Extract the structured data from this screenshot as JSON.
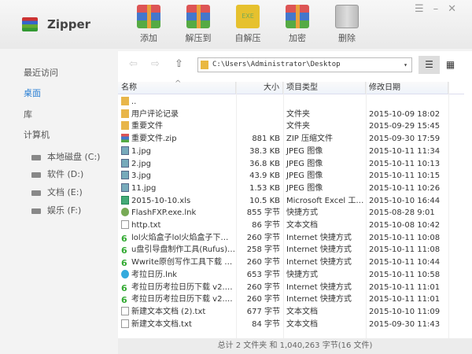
{
  "app": {
    "title": "Zipper"
  },
  "toolbar": [
    {
      "label": "添加",
      "icon": "add-archive-icon"
    },
    {
      "label": "解压到",
      "icon": "extract-icon"
    },
    {
      "label": "自解压",
      "icon": "sfx-exe-icon",
      "badge": "EXE"
    },
    {
      "label": "加密",
      "icon": "encrypt-icon"
    },
    {
      "label": "删除",
      "icon": "trash-icon"
    }
  ],
  "window_controls": {
    "menu": "☰",
    "minimize": "–",
    "close": "✕"
  },
  "sidebar": {
    "items": [
      {
        "label": "最近访问"
      },
      {
        "label": "桌面",
        "active": true
      },
      {
        "label": "库"
      },
      {
        "label": "计算机"
      }
    ],
    "drives": [
      {
        "label": "本地磁盘 (C:)"
      },
      {
        "label": "软件 (D:)"
      },
      {
        "label": "文档 (E:)"
      },
      {
        "label": "娱乐 (F:)"
      }
    ]
  },
  "nav": {
    "back": "⇦",
    "forward": "⇨",
    "up": "⇧",
    "path": "C:\\Users\\Administrator\\Desktop",
    "dropdown": "▾",
    "list_view": "☰",
    "grid_view": "▦"
  },
  "columns": {
    "name": "名称",
    "size": "大小",
    "type": "项目类型",
    "date": "修改日期",
    "sort_indicator": "^"
  },
  "files": [
    {
      "name": "..",
      "size": "",
      "type": "",
      "date": "",
      "icon": "folder"
    },
    {
      "name": "用户评论记录",
      "size": "",
      "type": "文件夹",
      "date": "2015-10-09 18:02",
      "icon": "folder"
    },
    {
      "name": "重要文件",
      "size": "",
      "type": "文件夹",
      "date": "2015-09-29 15:45",
      "icon": "folder"
    },
    {
      "name": "重要文件.zip",
      "size": "881 KB",
      "type": "ZIP 压缩文件",
      "date": "2015-09-30 17:59",
      "icon": "zip"
    },
    {
      "name": "1.jpg",
      "size": "38.3 KB",
      "type": "JPEG 图像",
      "date": "2015-10-11 11:34",
      "icon": "img"
    },
    {
      "name": "2.jpg",
      "size": "36.8 KB",
      "type": "JPEG 图像",
      "date": "2015-10-11 10:13",
      "icon": "img"
    },
    {
      "name": "3.jpg",
      "size": "43.9 KB",
      "type": "JPEG 图像",
      "date": "2015-10-11 10:15",
      "icon": "img"
    },
    {
      "name": "11.jpg",
      "size": "1.53 KB",
      "type": "JPEG 图像",
      "date": "2015-10-11 10:26",
      "icon": "img"
    },
    {
      "name": "2015-10-10.xls",
      "size": "10.5 KB",
      "type": "Microsoft Excel 工作...",
      "date": "2015-10-10 16:44",
      "icon": "xls"
    },
    {
      "name": "FlashFXP.exe.lnk",
      "size": "855 字节",
      "type": "快捷方式",
      "date": "2015-08-28 9:01",
      "icon": "lnk"
    },
    {
      "name": "http.txt",
      "size": "86 字节",
      "type": "文本文档",
      "date": "2015-10-08 10:42",
      "icon": "txt"
    },
    {
      "name": "lol火焰盒子lol火焰盒子下载 V...",
      "size": "260 字节",
      "type": "Internet 快捷方式",
      "date": "2015-10-11 10:08",
      "icon": "url"
    },
    {
      "name": "u盘引导盘制作工具(Rufus)下...",
      "size": "258 字节",
      "type": "Internet 快捷方式",
      "date": "2015-10-11 11:08",
      "icon": "url"
    },
    {
      "name": "Wwrite原创写作工具下载 6.1...",
      "size": "260 字节",
      "type": "Internet 快捷方式",
      "date": "2015-10-11 10:44",
      "icon": "url"
    },
    {
      "name": "考拉日历.lnk",
      "size": "653 字节",
      "type": "快捷方式",
      "date": "2015-10-11 10:58",
      "icon": "kaola"
    },
    {
      "name": "考拉日历考拉日历下载 v2.0.1...",
      "size": "260 字节",
      "type": "Internet 快捷方式",
      "date": "2015-10-11 11:01",
      "icon": "url"
    },
    {
      "name": "考拉日历考拉日历下载 v2.0.1...",
      "size": "260 字节",
      "type": "Internet 快捷方式",
      "date": "2015-10-11 11:01",
      "icon": "url"
    },
    {
      "name": "新建文本文档 (2).txt",
      "size": "677 字节",
      "type": "文本文档",
      "date": "2015-10-10 11:09",
      "icon": "txt"
    },
    {
      "name": "新建文本文档.txt",
      "size": "84 字节",
      "type": "文本文档",
      "date": "2015-09-30 11:43",
      "icon": "txt"
    }
  ],
  "status": "总计 2 文件夹 和 1,040,263 字节(16 文件)",
  "colors": {
    "accent": "#2a7fd4"
  }
}
